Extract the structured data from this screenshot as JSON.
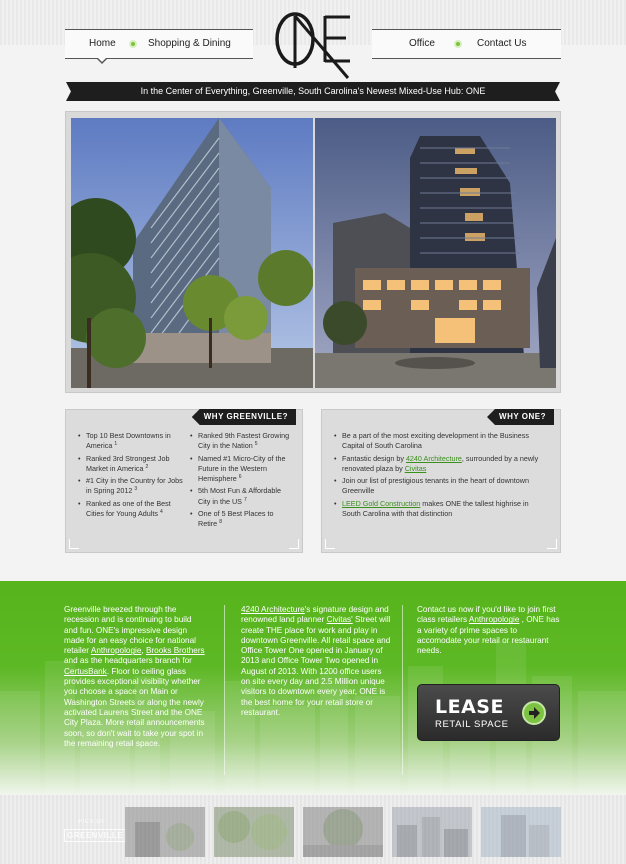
{
  "nav": {
    "home": "Home",
    "shopping": "Shopping & Dining",
    "office": "Office",
    "contact": "Contact Us"
  },
  "banner": "In the Center of Everything, Greenville, South Carolina's Newest Mixed-Use Hub: ONE",
  "why_greenville": {
    "title": "WHY GREENVILLE?",
    "col1": [
      {
        "text": "Top 10 Best Downtowns in America",
        "ref": "1"
      },
      {
        "text": "Ranked 3rd Strongest Job Market in America",
        "ref": "2"
      },
      {
        "text": "#1 City in the Country for Jobs in Spring 2012",
        "ref": "3"
      },
      {
        "text": "Ranked as one of the Best Cities for Young Adults",
        "ref": "4"
      }
    ],
    "col2": [
      {
        "text": "Ranked 9th Fastest Growing City in the Nation",
        "ref": "5"
      },
      {
        "text": "Named #1 Micro-City of the Future in the Western Hemisphere",
        "ref": "6"
      },
      {
        "text": "5th Most Fun & Affordable City in the US",
        "ref": "7"
      },
      {
        "text": "One of 5 Best Places to Retire",
        "ref": "8"
      }
    ]
  },
  "why_one": {
    "title": "WHY ONE?",
    "item1": "Be a part of the most exciting development in the Business Capital of South Carolina",
    "item2_pre": "Fantastic design by ",
    "item2_link1": "4240 Architecture",
    "item2_mid": ", surrounded by a newly renovated plaza by ",
    "item2_link2": "Civitas",
    "item3": "Join our list of prestigious tenants in the heart of downtown Greenville",
    "item4_link": "LEED Gold Construction",
    "item4_post": " makes ONE the tallest highrise in South Carolina with that distinction"
  },
  "green": {
    "col1_a": "Greenville breezed through the recession and is continuing to build and fun. ONE's impressive design made for an easy choice for national retailer ",
    "col1_link1": "Anthropologie",
    "col1_b": ", ",
    "col1_link2": "Brooks Brothers",
    "col1_c": " and as the headquarters branch for ",
    "col1_link3": "CertusBank",
    "col1_d": ". Floor to ceiling glass provides exceptional visibility whether you choose a space on Main or Washington Streets or along the newly activated Laurens Street and the ONE City Plaza. More retail announcements soon, so don't wait to take your spot in the remaining retail space.",
    "col2_link1": "4240 Architecture",
    "col2_a": "'s signature design and renowned land planner ",
    "col2_link2": "Civitas'",
    "col2_b": " Street will create THE place for work and play in downtown Greenville. All retail space and Office Tower One opened in January of 2013 and Office Tower Two opened in August of 2013. With 1200 office users on site every day and 2.5 Million unique visitors to downtown every year, ONE is the best home for your retail store or restaurant.",
    "col3_a": "Contact us now if you'd like to join first class retailers ",
    "col3_link": "Anthropologie",
    "col3_b": " , ONE has a variety of prime spaces to accomodate your retail or restaurant needs."
  },
  "lease": {
    "title": "LEASE",
    "subtitle": "RETAIL SPACE"
  },
  "pics": {
    "small": "PICS OF",
    "big": "GREENVILLE"
  }
}
